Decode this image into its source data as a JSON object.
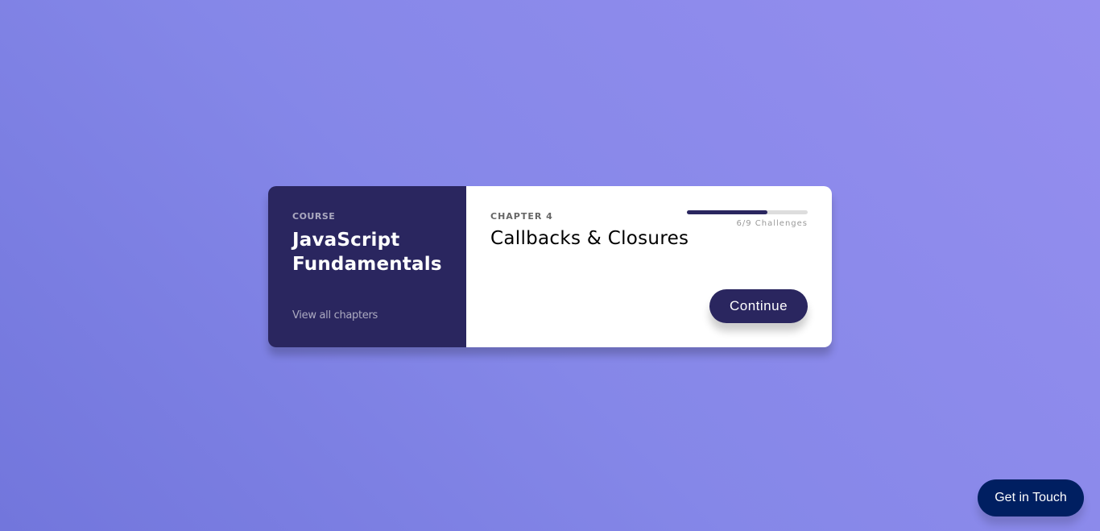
{
  "course": {
    "kicker": "Course",
    "title": "JavaScript Fundamentals",
    "link": "View all chapters"
  },
  "chapter": {
    "kicker": "Chapter 4",
    "title": "Callbacks & Closures"
  },
  "progress": {
    "completed": 6,
    "total": 9,
    "fraction": 0.6667,
    "label": "6/9 Challenges"
  },
  "buttons": {
    "continue": "Continue",
    "contact": "Get in Touch"
  },
  "colors": {
    "accent": "#2a265f",
    "contact": "#001f61",
    "background_start": "#7276dc",
    "background_end": "#958eef"
  }
}
